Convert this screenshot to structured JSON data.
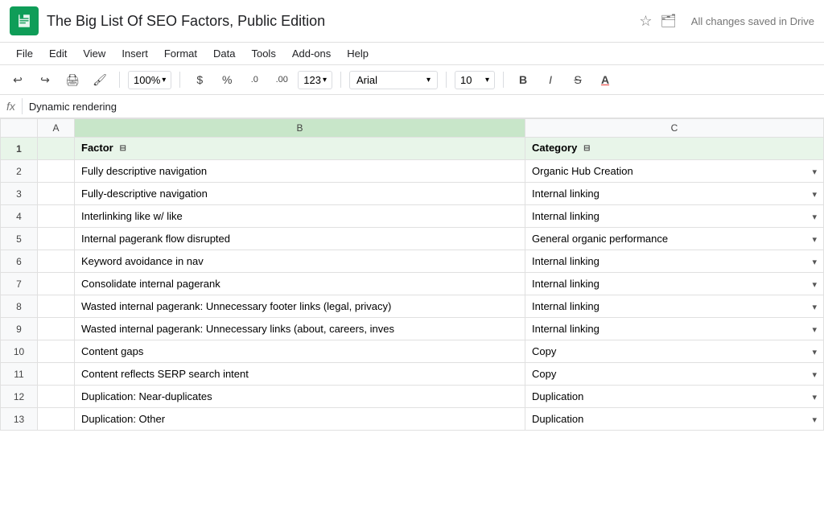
{
  "app": {
    "icon_color": "#0f9d58",
    "title": "The Big List Of SEO Factors, Public Edition",
    "save_status": "All changes saved in Drive"
  },
  "menu": {
    "items": [
      "File",
      "Edit",
      "View",
      "Insert",
      "Format",
      "Data",
      "Tools",
      "Add-ons",
      "Help"
    ]
  },
  "toolbar": {
    "zoom": "100%",
    "currency": "$",
    "percent": "%",
    "decimal_dec": ".0",
    "decimal_inc": ".00",
    "number_format": "123",
    "font": "Arial",
    "font_size": "10",
    "bold": "B",
    "italic": "I",
    "strikethrough": "S",
    "font_color": "A"
  },
  "formula_bar": {
    "fx": "fx",
    "content": "Dynamic rendering"
  },
  "columns": {
    "row_num": "",
    "a": "A",
    "b": "B",
    "c": "C"
  },
  "rows": [
    {
      "num": "1",
      "factor": "Factor",
      "category": "Category",
      "is_header": true
    },
    {
      "num": "2",
      "factor": "Fully descriptive navigation",
      "category": "Organic Hub Creation"
    },
    {
      "num": "3",
      "factor": "Fully-descriptive navigation",
      "category": "Internal linking"
    },
    {
      "num": "4",
      "factor": "Interlinking like w/ like",
      "category": "Internal linking"
    },
    {
      "num": "5",
      "factor": "Internal pagerank flow disrupted",
      "category": "General organic performance"
    },
    {
      "num": "6",
      "factor": "Keyword avoidance in nav",
      "category": "Internal linking"
    },
    {
      "num": "7",
      "factor": "Consolidate internal pagerank",
      "category": "Internal linking"
    },
    {
      "num": "8",
      "factor": "Wasted internal pagerank: Unnecessary footer links (legal, privacy)",
      "category": "Internal linking"
    },
    {
      "num": "9",
      "factor": "Wasted internal pagerank: Unnecessary links (about, careers, inves",
      "category": "Internal linking"
    },
    {
      "num": "10",
      "factor": "Content gaps",
      "category": "Copy"
    },
    {
      "num": "11",
      "factor": "Content reflects SERP search intent",
      "category": "Copy"
    },
    {
      "num": "12",
      "factor": "Duplication: Near-duplicates",
      "category": "Duplication"
    },
    {
      "num": "13",
      "factor": "Duplication: Other",
      "category": "Duplication"
    }
  ]
}
